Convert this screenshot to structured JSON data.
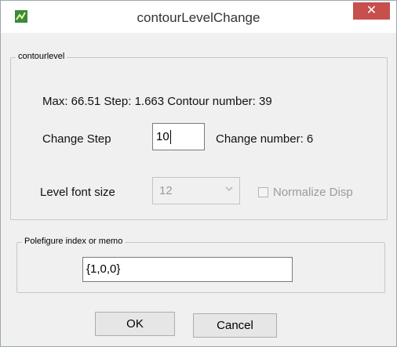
{
  "window": {
    "title": "contourLevelChange",
    "close_glyph": "✕"
  },
  "contour_group": {
    "label": "contourlevel",
    "info": "Max: 66.51  Step: 1.663  Contour number: 39",
    "change_step_label": "Change Step",
    "change_step_value": "10",
    "change_number": "Change number: 6",
    "level_font_label": "Level font size",
    "level_font_value": "12",
    "normalize_label": "Normalize Disp"
  },
  "memo_group": {
    "label": "Polefigure index or memo",
    "value": "{1,0,0}"
  },
  "buttons": {
    "ok": "OK",
    "cancel": "Cancel"
  },
  "icons": {
    "app": "app-icon",
    "close": "close-icon",
    "dropdown": "chevron-down-icon"
  },
  "colors": {
    "close_bg": "#c7504c",
    "window_bg": "#f0f0f0"
  }
}
